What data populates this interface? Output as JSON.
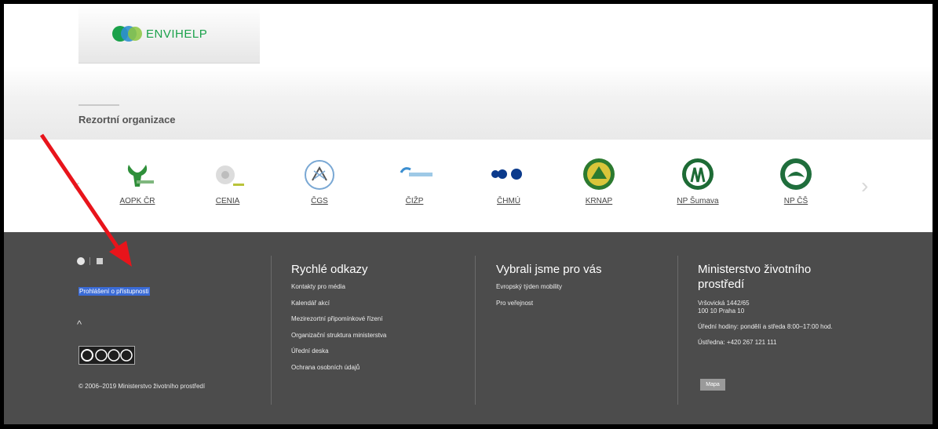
{
  "envihelp": {
    "label": "ENVIHELP"
  },
  "rezort": {
    "title": "Rezortní organizace"
  },
  "carousel": {
    "prev": "‹",
    "next": "›",
    "orgs": [
      {
        "name": "AOPK ČR",
        "icon": "aopk-logo-icon"
      },
      {
        "name": "CENIA",
        "icon": "cenia-logo-icon"
      },
      {
        "name": "ČGS",
        "icon": "cgs-logo-icon"
      },
      {
        "name": "ČIŽP",
        "icon": "cizp-logo-icon"
      },
      {
        "name": "ČHMÚ",
        "icon": "chmu-logo-icon"
      },
      {
        "name": "KRNAP",
        "icon": "krnap-logo-icon"
      },
      {
        "name": "NP Šumava",
        "icon": "np-sumava-logo-icon"
      },
      {
        "name": "NP ČŠ",
        "icon": "np-cs-logo-icon"
      }
    ]
  },
  "footer": {
    "accessibility": "Prohlášení o přístupnosti",
    "up": "^",
    "copyright": "© 2006–2019 Ministerstvo životního prostředí",
    "col1": {
      "title": "Rychlé odkazy",
      "links": [
        "Kontakty pro média",
        "Kalendář akcí",
        "Mezirezortní připomínkové řízení",
        "Organizační struktura ministerstva",
        "Úřední deska",
        "Ochrana osobních údajů"
      ]
    },
    "col2": {
      "title": "Vybrali jsme pro vás",
      "links": [
        "Evropský týden mobility",
        "Pro veřejnost"
      ]
    },
    "col3": {
      "title_line1": "Ministerstvo životního",
      "title_line2": "prostředí",
      "address1": "Vršovická 1442/65",
      "address2": "100 10 Praha 10",
      "hours": "Úřední hodiny: pondělí a středa 8:00–17:00 hod.",
      "phone": "Ústředna: +420 267 121 111",
      "map_button": "Mapa"
    }
  },
  "colors": {
    "accent_green": "#1aa14a",
    "footer_bg": "#4c4c4c",
    "arrow_red": "#e8141b",
    "highlight": "#3a6bd6"
  }
}
